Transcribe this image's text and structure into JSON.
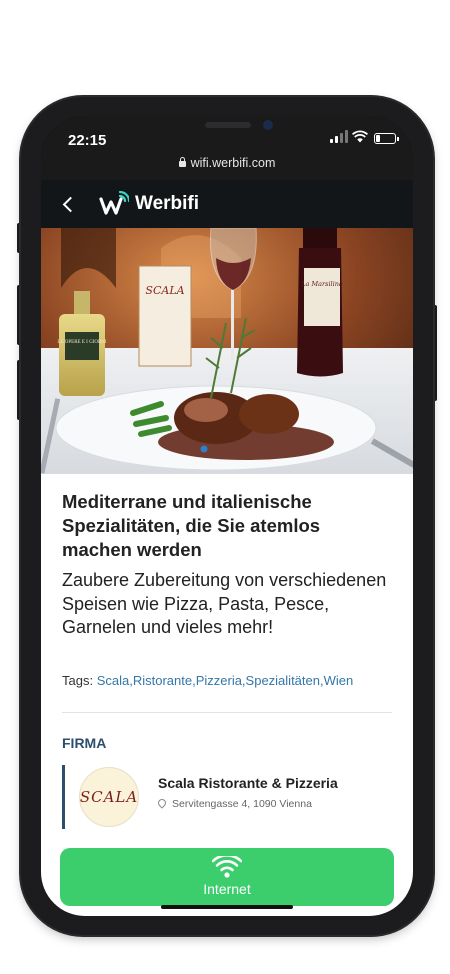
{
  "status_bar": {
    "time": "22:15",
    "url": "wifi.werbifi.com"
  },
  "app_bar": {
    "brand": "Werbifi"
  },
  "hero": {
    "card_text": "SCALA",
    "bottle_label": "La Marsilina",
    "oil_label": "LE OPERE E I GIORNI"
  },
  "article": {
    "title": "Mediterrane und italienische Spezialitäten, die Sie atemlos machen werden",
    "description": "Zaubere Zubereitung von verschiedenen Speisen wie Pizza, Pasta, Pesce, Garnelen und vieles mehr!",
    "tags_label": "Tags:",
    "tags": "Scala,Ristorante,Pizzeria,Spezialitäten,Wien"
  },
  "company": {
    "section_label": "FIRMA",
    "logo_text": "SCALA",
    "name": "Scala Ristorante & Pizzeria",
    "address": "Servitengasse 4, 1090 Vienna"
  },
  "cta": {
    "label": "Internet"
  },
  "colors": {
    "accent_green": "#3ccd6d",
    "brand_dark": "#131618",
    "link_blue": "#3477a8",
    "section_blue": "#2d4f6e"
  }
}
